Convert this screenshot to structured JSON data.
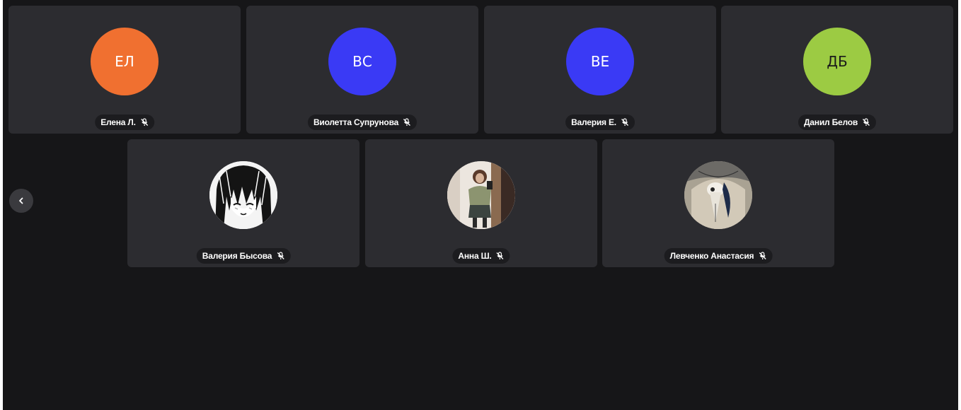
{
  "participants": [
    {
      "initials": "ЕЛ",
      "name": "Елена Л.",
      "avatar_color": "#f07030",
      "initials_color": "#ffffff",
      "muted": true
    },
    {
      "initials": "ВС",
      "name": "Виолетта Супрунова",
      "avatar_color": "#3a3af5",
      "initials_color": "#ffffff",
      "muted": true
    },
    {
      "initials": "ВЕ",
      "name": "Валерия Е.",
      "avatar_color": "#3a3af5",
      "initials_color": "#ffffff",
      "muted": true
    },
    {
      "initials": "ДБ",
      "name": "Данил Белов",
      "avatar_color": "#9ccb43",
      "initials_color": "#1a1a1a",
      "muted": true
    },
    {
      "initials": "",
      "name": "Валерия Бысова",
      "avatar_image": "anime-portrait",
      "muted": true
    },
    {
      "initials": "",
      "name": "Анна Ш.",
      "avatar_image": "mirror-selfie-photo",
      "muted": true
    },
    {
      "initials": "",
      "name": "Левченко Анастасия",
      "avatar_image": "bird-skull-photo",
      "muted": true
    }
  ],
  "icons": {
    "mic": "mic-muted-icon",
    "prev": "chevron-left-icon"
  }
}
